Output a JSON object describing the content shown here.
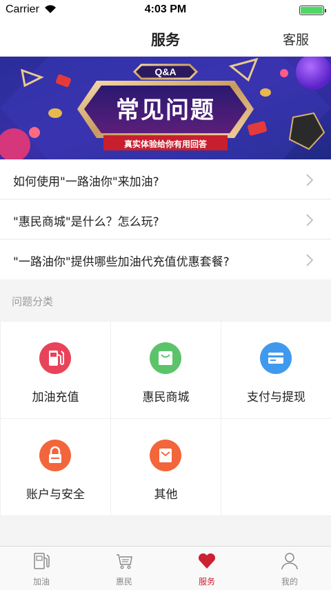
{
  "status_bar": {
    "carrier": "Carrier",
    "time": "4:03 PM",
    "battery_level": 1.0
  },
  "nav": {
    "title": "服务",
    "right_button": "客服"
  },
  "banner": {
    "badge": "Q&A",
    "title": "常见问题",
    "subtitle": "真实体验给你有用回答"
  },
  "faq": [
    {
      "text": "如何使用\"一路油你\"来加油?"
    },
    {
      "text": "\"惠民商城\"是什么？怎么玩?"
    },
    {
      "text": "\"一路油你\"提供哪些加油代充值优惠套餐?"
    }
  ],
  "categories_label": "问题分类",
  "categories": [
    {
      "label": "加油充值",
      "icon": "fuel-pump-icon",
      "color": "#e8435a"
    },
    {
      "label": "惠民商城",
      "icon": "shop-bag-icon",
      "color": "#5cc36a"
    },
    {
      "label": "支付与提现",
      "icon": "card-icon",
      "color": "#3f9aee"
    },
    {
      "label": "账户与安全",
      "icon": "lock-icon",
      "color": "#f3653a"
    },
    {
      "label": "其他",
      "icon": "envelope-icon",
      "color": "#f3653a"
    }
  ],
  "tabs": [
    {
      "label": "加油",
      "icon": "fuel-icon",
      "active": false
    },
    {
      "label": "惠民",
      "icon": "cart-icon",
      "active": false
    },
    {
      "label": "服务",
      "icon": "heart-icon",
      "active": true
    },
    {
      "label": "我的",
      "icon": "user-icon",
      "active": false
    }
  ],
  "colors": {
    "accent": "#cc2131",
    "background": "#f4f4f4"
  }
}
